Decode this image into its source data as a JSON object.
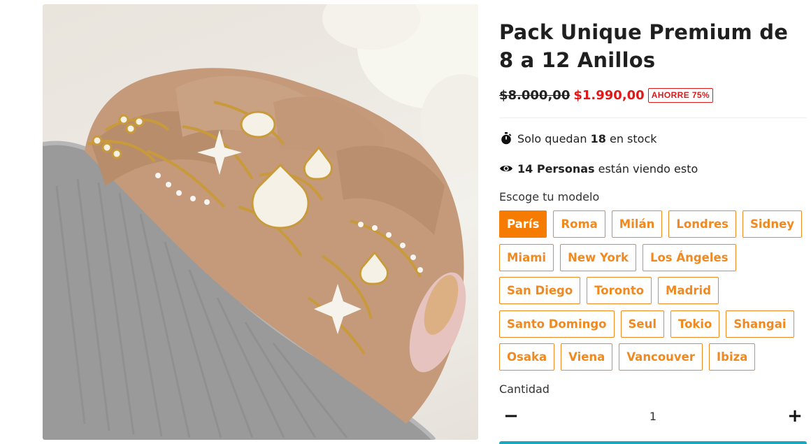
{
  "product": {
    "title": "Pack Unique Premium de 8 a 12 Anillos",
    "old_price": "$8.000,00",
    "new_price": "$1.990,00",
    "save_badge": "AHORRE 75%"
  },
  "stock": {
    "prefix": "Solo quedan",
    "count": "18",
    "suffix": "en stock"
  },
  "viewers": {
    "count_label": "14 Personas",
    "suffix": "están viendo esto"
  },
  "model": {
    "label": "Escoge tu modelo",
    "rows": [
      [
        "París",
        "Roma",
        "Milán",
        "Londres",
        "Sidney"
      ],
      [
        "Miami",
        "New York",
        "Los Ángeles"
      ],
      [
        "San Diego",
        "Toronto",
        "Madrid"
      ],
      [
        "Santo Domingo",
        "Seul",
        "Tokio",
        "Shangai"
      ],
      [
        "Osaka",
        "Viena",
        "Vancouver",
        "Ibiza"
      ]
    ],
    "selected": "París"
  },
  "quantity": {
    "label": "Cantidad",
    "value": "1",
    "minus": "−",
    "plus": "+"
  },
  "colors": {
    "accent": "#f57c00",
    "sale": "#e01818",
    "cta": "#1aa7c4"
  },
  "icons": {
    "stock": "stopwatch-icon",
    "viewers": "eye-icon"
  }
}
